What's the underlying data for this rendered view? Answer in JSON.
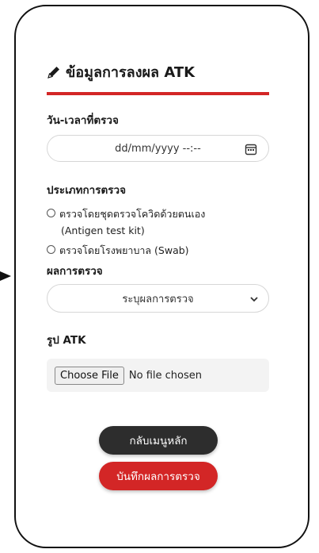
{
  "form": {
    "title": "ข้อมูลการลงผล ATK",
    "title_icon": "pencil-icon",
    "accent_color": "#d32626",
    "date_label": "วัน-เวลาที่ตรวจ",
    "date_placeholder": "dd/mm/yyyy --:--",
    "test_type_label": "ประเภทการตรวจ",
    "test_type_options": [
      {
        "line1": "ตรวจโดยชุดตรวจโควิดด้วยตนเอง",
        "line2": "(Antigen test kit)"
      },
      {
        "line1": "ตรวจโดยโรงพยาบาล (Swab)"
      }
    ],
    "result_label": "ผลการตรวจ",
    "result_select_value": "ระบุผลการตรวจ",
    "photo_label": "รูป ATK",
    "file_button_label": "Choose File",
    "file_status": "No file chosen",
    "back_button_label": "กลับเมนูหลัก",
    "save_button_label": "บันทึกผลการตรวจ"
  }
}
